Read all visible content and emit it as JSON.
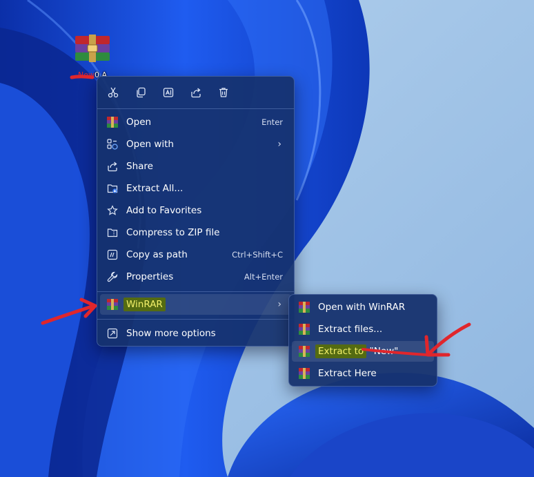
{
  "desktop": {
    "file_icon": {
      "name": "winrar-archive-icon",
      "label_visible": "0 A",
      "label_redacted": "New"
    }
  },
  "context_menu": {
    "toolbar": [
      {
        "name": "cut-icon"
      },
      {
        "name": "copy-icon"
      },
      {
        "name": "rename-icon"
      },
      {
        "name": "share-icon"
      },
      {
        "name": "delete-icon"
      }
    ],
    "items": [
      {
        "label": "Open",
        "accel": "Enter",
        "icon": "winrar-icon"
      },
      {
        "label": "Open with",
        "accel": "",
        "icon": "open-with-icon",
        "submenu": true
      },
      {
        "label": "Share",
        "accel": "",
        "icon": "share-icon"
      },
      {
        "label": "Extract All...",
        "accel": "",
        "icon": "extract-all-icon"
      },
      {
        "label": "Add to Favorites",
        "accel": "",
        "icon": "star-icon"
      },
      {
        "label": "Compress to ZIP file",
        "accel": "",
        "icon": "zip-icon"
      },
      {
        "label": "Copy as path",
        "accel": "Ctrl+Shift+C",
        "icon": "copy-path-icon"
      },
      {
        "label": "Properties",
        "accel": "Alt+Enter",
        "icon": "wrench-icon"
      }
    ],
    "winrar": {
      "label": "WinRAR",
      "chevron": "›"
    },
    "more": {
      "label": "Show more options"
    }
  },
  "winrar_submenu": {
    "items": [
      {
        "label": "Open with WinRAR"
      },
      {
        "label": "Extract files..."
      },
      {
        "label": "Extract to",
        "suffix": "\"New\""
      },
      {
        "label": "Extract Here"
      }
    ]
  },
  "colors": {
    "menu_bg": "#16326e",
    "highlight_bg": "#546b12",
    "highlight_text": "#f3f06a",
    "annotation_red": "#e0262c",
    "wallpaper_light": "#9ec3e6",
    "wallpaper_blue": "#1a4fd6"
  }
}
